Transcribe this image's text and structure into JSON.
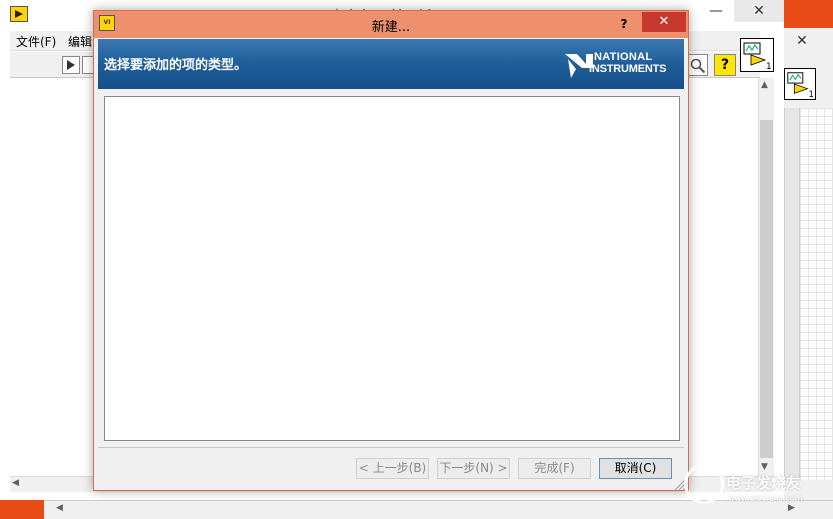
{
  "background_window": {
    "title": "未命名 1 前面板",
    "min_glyph": "—",
    "close_glyph": "✕",
    "menu": {
      "file": "文件(F)",
      "edit": "编辑"
    },
    "help_glyph": "?",
    "vi_icon_label": "1"
  },
  "block_diagram_window": {
    "close_glyph": "✕",
    "vi_icon_label": "1"
  },
  "dialog": {
    "title": "新建...",
    "help_glyph": "?",
    "close_glyph": "✕",
    "header_text": "选择要添加的项的类型。",
    "logo_line1": "NATIONAL",
    "logo_line2": "INSTRUMENTS",
    "buttons": {
      "back": "< 上一步(B)",
      "next": "下一步(N) >",
      "finish": "完成(F)",
      "cancel": "取消(C)"
    }
  },
  "watermark": {
    "cn": "电子发烧友",
    "url": "www.elecfans.com"
  },
  "colors": {
    "dialog_title_bar": "#ee8f6d",
    "dialog_close": "#c7392e",
    "header_blue": "#1d5b98",
    "accent_orange": "#e84b16"
  }
}
